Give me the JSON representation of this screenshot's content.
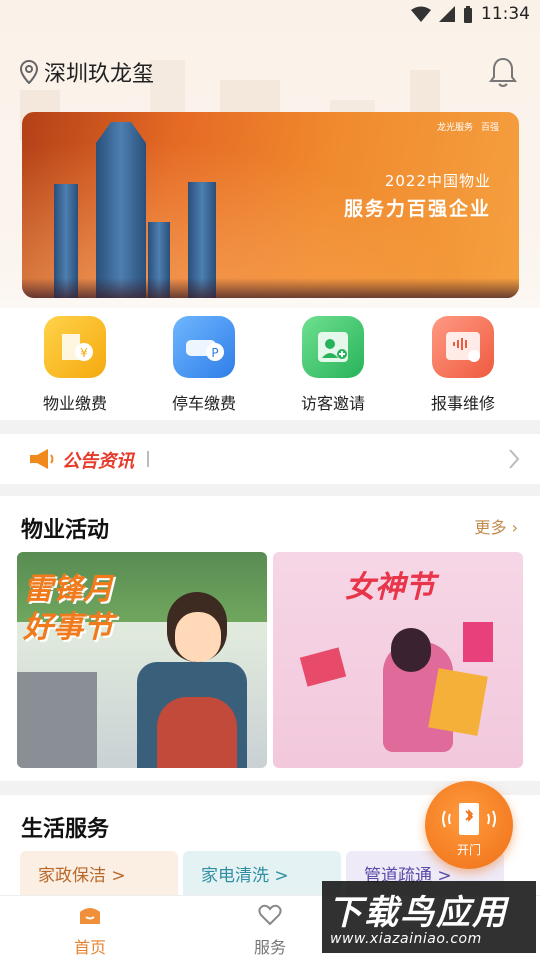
{
  "status": {
    "time": "11:34"
  },
  "header": {
    "location": "深圳玖龙玺"
  },
  "banner": {
    "logo_a": "龙光服务",
    "logo_b": "百强",
    "line1": "2022中国物业",
    "line2": "服务力百强企业"
  },
  "quick": [
    {
      "label": "物业缴费",
      "icon": "property-fee-icon",
      "color": "#f7b419"
    },
    {
      "label": "停车缴费",
      "icon": "parking-fee-icon",
      "color": "#3d8ef0"
    },
    {
      "label": "访客邀请",
      "icon": "visitor-invite-icon",
      "color": "#3ec46d"
    },
    {
      "label": "报事维修",
      "icon": "repair-report-icon",
      "color": "#f56a4e"
    }
  ],
  "notice": {
    "tag": "公告资讯"
  },
  "activities": {
    "title": "物业活动",
    "more": "更多",
    "cards": [
      {
        "title_line1": "雷锋月",
        "title_line2": "好事节"
      },
      {
        "title": "女神节"
      }
    ]
  },
  "life": {
    "title": "生活服务",
    "items": [
      {
        "label": "家政保洁 >",
        "bg": "#fbeee2",
        "fg": "#b8682a"
      },
      {
        "label": "家电清洗 >",
        "bg": "#e4f2f4",
        "fg": "#2f8fa0"
      },
      {
        "label": "管道疏通 >",
        "bg": "#eeeaf7",
        "fg": "#5a4aa8"
      }
    ]
  },
  "fab": {
    "label": "开门"
  },
  "tabs": [
    {
      "label": "首页",
      "active": true
    },
    {
      "label": "服务",
      "active": false
    }
  ],
  "watermark": {
    "big": "下载鸟应用",
    "small": "www.xiazainiao.com"
  },
  "colors": {
    "accent": "#f07018",
    "active_tab": "#e8842f"
  }
}
